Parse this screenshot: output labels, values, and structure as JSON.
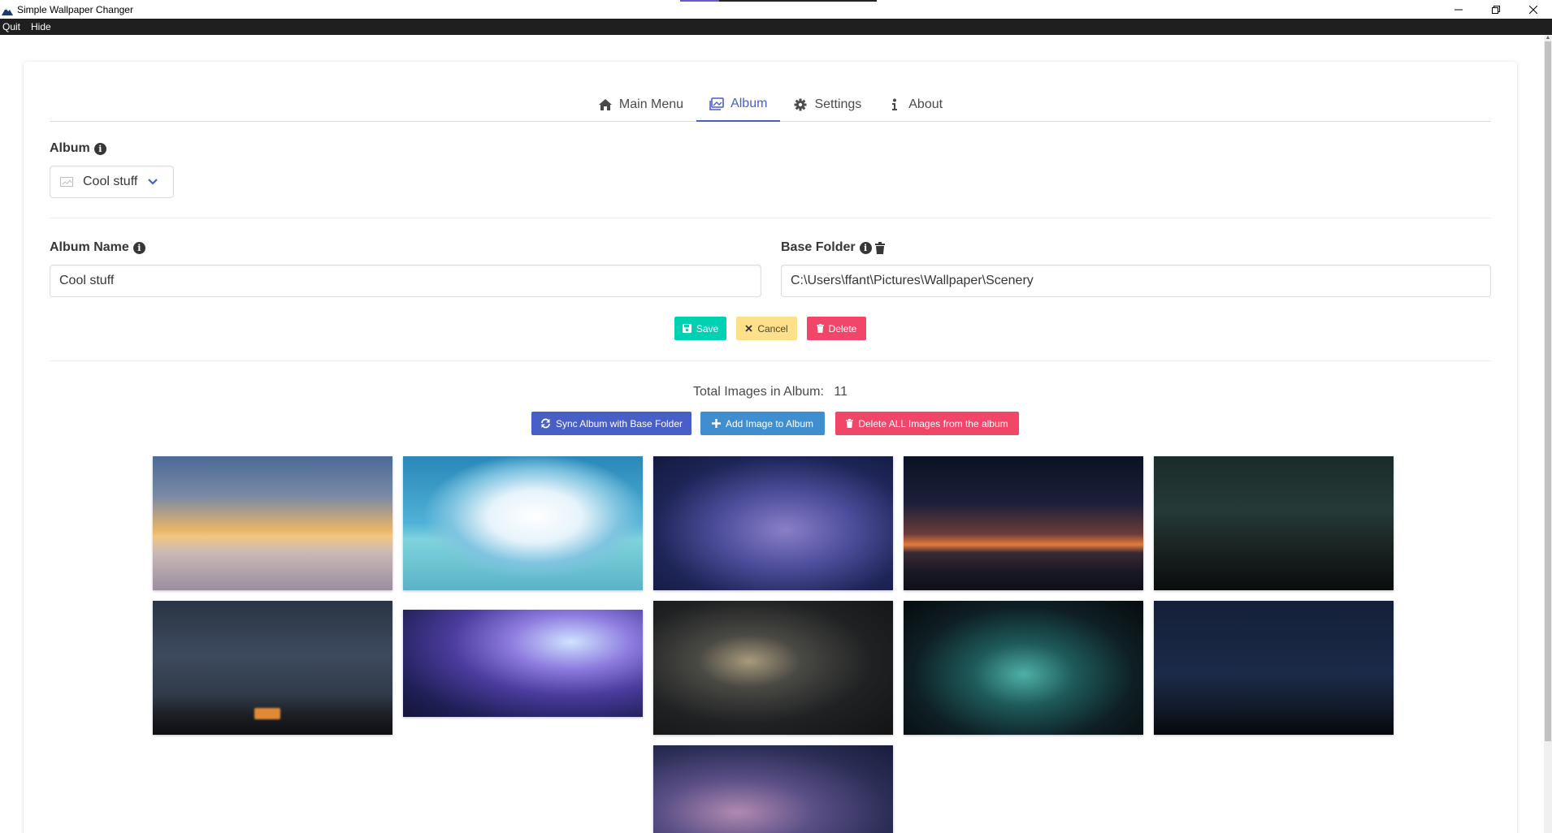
{
  "window": {
    "title": "Simple Wallpaper Changer",
    "minimize": "—",
    "restore": "❐",
    "close": "✕"
  },
  "menu": {
    "items": [
      {
        "label": "Quit"
      },
      {
        "label": "Hide"
      }
    ]
  },
  "tabs": [
    {
      "label": "Main Menu",
      "icon": "home-icon",
      "active": false
    },
    {
      "label": "Album",
      "icon": "images-icon",
      "active": true
    },
    {
      "label": "Settings",
      "icon": "gear-icon",
      "active": false
    },
    {
      "label": "About",
      "icon": "info-icon",
      "active": false
    }
  ],
  "album_select": {
    "label": "Album",
    "selected": "Cool stuff"
  },
  "album_name": {
    "label": "Album Name",
    "value": "Cool stuff"
  },
  "base_folder": {
    "label": "Base Folder",
    "value": "C:\\Users\\ffant\\Pictures\\Wallpaper\\Scenery"
  },
  "form_buttons": {
    "save": "Save",
    "cancel": "Cancel",
    "delete": "Delete"
  },
  "album_info": {
    "total_label": "Total Images in Album:",
    "total_count": "11"
  },
  "album_buttons": {
    "sync": "Sync Album with Base Folder",
    "add": "Add Image to Album",
    "delete_all": "Delete ALL Images from the album"
  },
  "colors": {
    "primary": "#485fc7",
    "save": "#00d1b2",
    "cancel": "#ffe08a",
    "danger": "#f14668",
    "info": "#3e8ed0",
    "menubar": "#1f1f1f"
  },
  "thumbnails": [
    {
      "name": "sunset-clouds-thumbnail"
    },
    {
      "name": "cloud-ocean-thumbnail"
    },
    {
      "name": "milky-way-blue-thumbnail"
    },
    {
      "name": "mountain-night-thumbnail"
    },
    {
      "name": "dark-lake-stars-thumbnail"
    },
    {
      "name": "castle-night-thumbnail"
    },
    {
      "name": "floating-islands-thumbnail"
    },
    {
      "name": "galaxy-core-thumbnail"
    },
    {
      "name": "teal-milky-way-thumbnail"
    },
    {
      "name": "forest-stars-thumbnail"
    },
    {
      "name": "purple-galaxy-thumbnail"
    }
  ]
}
